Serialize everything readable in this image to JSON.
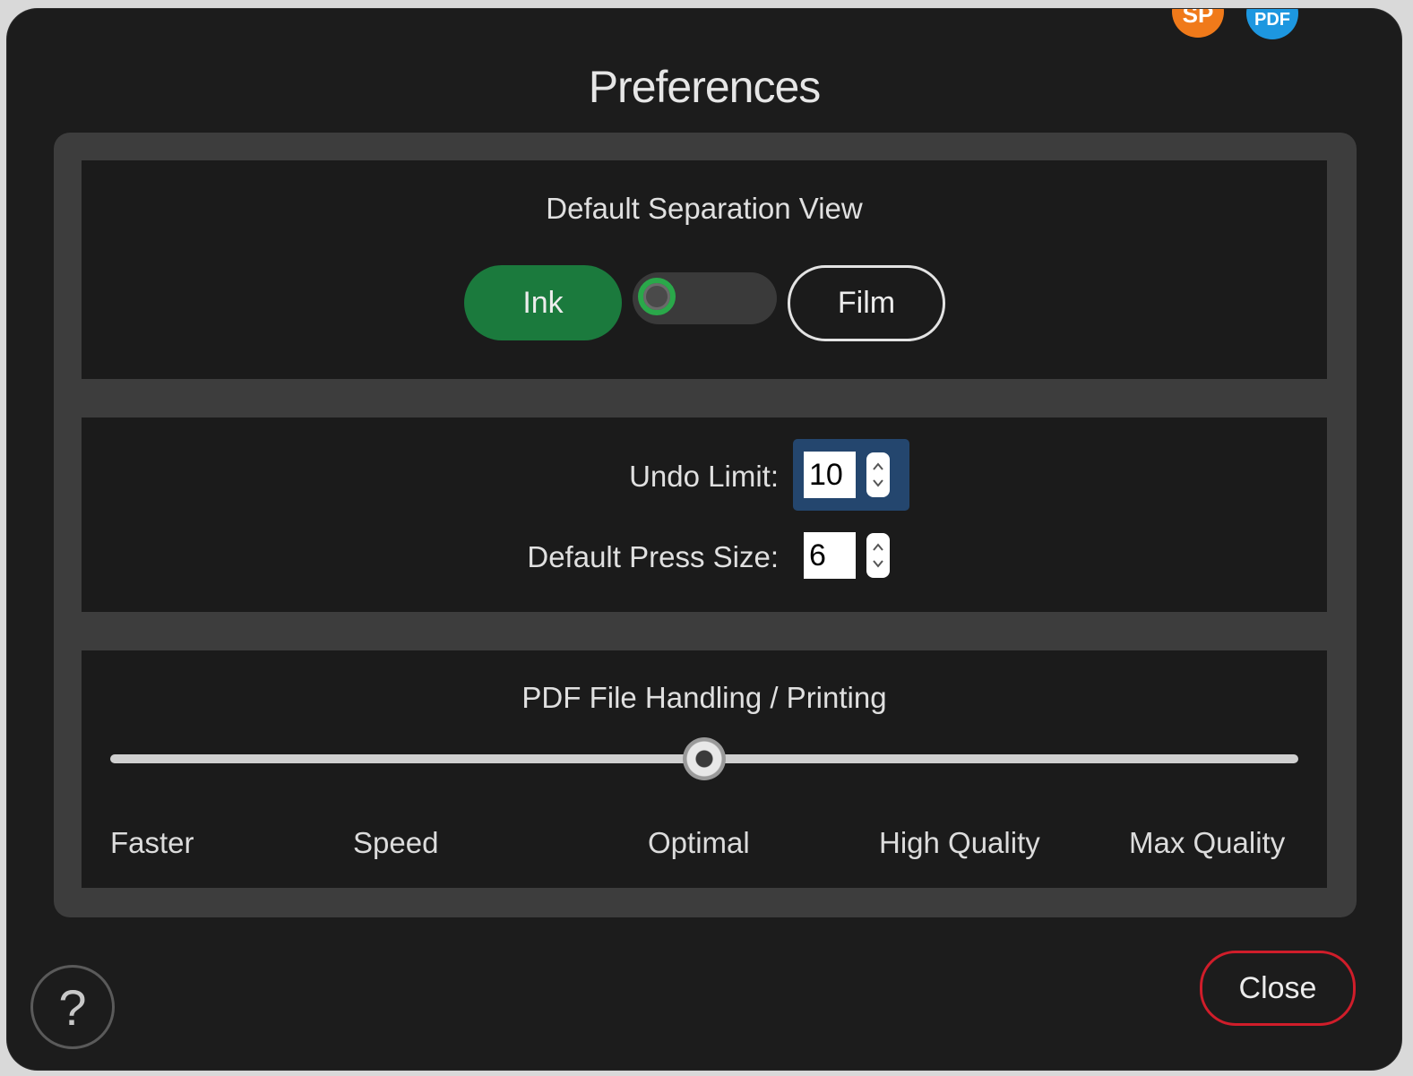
{
  "window": {
    "title": "Preferences"
  },
  "badges": {
    "sp": "SP",
    "pdf": "PDF"
  },
  "separation_view": {
    "heading": "Default Separation View",
    "ink_label": "Ink",
    "film_label": "Film",
    "selected": "Ink",
    "accent_color": "#1b7a3d"
  },
  "undo": {
    "undo_label": "Undo Limit:",
    "undo_value": "10",
    "press_label": "Default Press Size:",
    "press_value": "6"
  },
  "pdf_handling": {
    "heading": "PDF File Handling / Printing",
    "levels": [
      "Faster",
      "Speed",
      "Optimal",
      "High Quality",
      "Max Quality"
    ],
    "selected_index": 2,
    "selected_label": "Optimal"
  },
  "footer": {
    "help_label": "?",
    "close_label": "Close",
    "close_border_color": "#d01d2a"
  }
}
